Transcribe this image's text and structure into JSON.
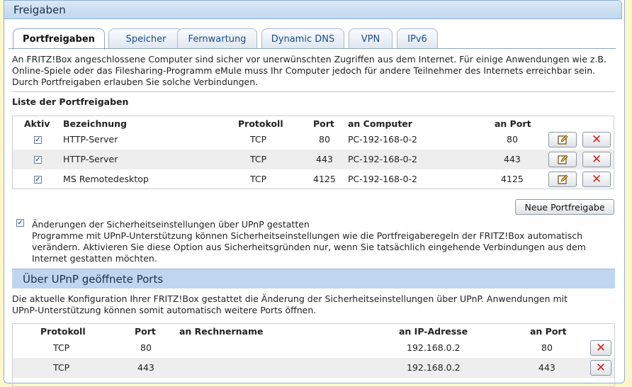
{
  "header": {
    "title": "Freigaben"
  },
  "tabs": [
    {
      "label": "Portfreigaben",
      "active": true
    },
    {
      "label": "Speicher",
      "active": false
    },
    {
      "label": "Fernwartung",
      "active": false
    },
    {
      "label": "Dynamic DNS",
      "active": false
    },
    {
      "label": "VPN",
      "active": false
    },
    {
      "label": "IPv6",
      "active": false
    }
  ],
  "intro": {
    "line1": "An FRITZ!Box angeschlossene Computer sind sicher vor unerwünschten Zugriffen aus dem Internet. Für einige Anwendungen wie z.B.",
    "line2": "Online-Spiele oder das Filesharing-Programm eMule muss Ihr Computer jedoch für andere Teilnehmer des Internets erreichbar sein.",
    "line3": "Durch Portfreigaben erlauben Sie solche Verbindungen."
  },
  "portlist": {
    "title": "Liste der Portfreigaben",
    "headers": {
      "aktiv": "Aktiv",
      "bezeichnung": "Bezeichnung",
      "protokoll": "Protokoll",
      "port": "Port",
      "computer": "an Computer",
      "anport": "an Port"
    },
    "rows": [
      {
        "active": true,
        "name": "HTTP-Server",
        "protocol": "TCP",
        "port": "80",
        "computer": "PC-192-168-0-2",
        "to_port": "80"
      },
      {
        "active": true,
        "name": "HTTP-Server",
        "protocol": "TCP",
        "port": "443",
        "computer": "PC-192-168-0-2",
        "to_port": "443"
      },
      {
        "active": true,
        "name": "MS Remotedesktop",
        "protocol": "TCP",
        "port": "4125",
        "computer": "PC-192-168-0-2",
        "to_port": "4125"
      }
    ],
    "new_button": "Neue Portfreigabe"
  },
  "upnp_option": {
    "checked": true,
    "label": "Änderungen der Sicherheitseinstellungen über UPnP gestatten",
    "desc1": "Programme mit UPnP-Unterstützung können Sicherheitseinstellungen wie die Portfreigaberegeln der FRITZ!Box automatisch",
    "desc2": "verändern. Aktivieren Sie diese Option aus Sicherheitsgründen nur, wenn Sie tatsächlich eingehende Verbindungen aus dem",
    "desc3": "Internet gestatten möchten."
  },
  "upnp_section": {
    "title": "Über UPnP geöffnete Ports",
    "intro1": "Die aktuelle Konfiguration Ihrer FRITZ!Box gestattet die Änderung der Sicherheitseinstellungen über UPnP. Anwendungen mit",
    "intro2": "UPnP-Unterstützung können somit automatisch weitere Ports öffnen.",
    "headers": {
      "protokoll": "Protokoll",
      "port": "Port",
      "rechnername": "an Rechnername",
      "ip": "an IP-Adresse",
      "anport": "an Port"
    },
    "rows": [
      {
        "protocol": "TCP",
        "port": "80",
        "hostname": "",
        "ip": "192.168.0.2",
        "to_port": "80"
      },
      {
        "protocol": "TCP",
        "port": "443",
        "hostname": "",
        "ip": "192.168.0.2",
        "to_port": "443"
      }
    ]
  },
  "icons": {
    "edit": "edit-icon",
    "delete": "delete-icon",
    "checkmark": "✓"
  },
  "colors": {
    "delete_red": "#d8241c",
    "accent_blue": "#bfd6ee"
  }
}
